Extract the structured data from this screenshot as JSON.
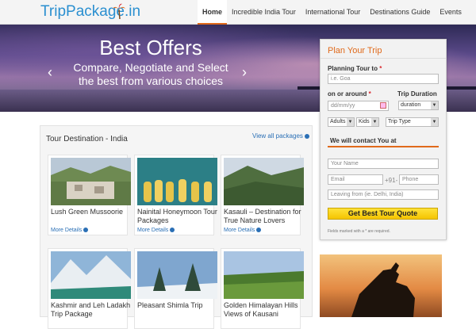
{
  "header": {
    "logo": "TripPackage.in",
    "nav": [
      "Home",
      "Incredible India Tour",
      "International Tour",
      "Destinations Guide",
      "Events"
    ]
  },
  "hero": {
    "title": "Best Offers",
    "subtitle_line1": "Compare, Negotiate and Select",
    "subtitle_line2": "the best from various choices",
    "prev": "‹",
    "next": "›"
  },
  "plan": {
    "title": "Plan Your Trip",
    "planning_label": "Planning Tour to",
    "planning_placeholder": "i.e. Goa",
    "on_or_around": "on or around",
    "trip_duration": "Trip Duration",
    "date_placeholder": "dd/mm/yy",
    "duration_value": "duration",
    "adults": "Adults",
    "kids": "Kids",
    "trip_type": "Trip Type",
    "contact_title": "We will contact You at",
    "name_placeholder": "Your Name",
    "email_placeholder": "Email",
    "phone_code": "+91-",
    "phone_placeholder": "Phone",
    "leaving_placeholder": "Leaving from (ie. Delhi, India)",
    "cta": "Get Best Tour Quote",
    "note": "Fields marked with a * are required."
  },
  "section": {
    "title": "Tour Destination - India",
    "view_all": "View all packages",
    "more_details": "More Details"
  },
  "cards": [
    {
      "title": "Lush Green Mussoorie",
      "more": true
    },
    {
      "title": "Nainital Honeymoon Tour Packages",
      "more": true
    },
    {
      "title": "Kasauli – Destination for True Nature Lovers",
      "more": true
    },
    {
      "title": "Kashmir and Leh Ladakh Trip Package",
      "more": false
    },
    {
      "title": "Pleasant Shimla Trip",
      "more": false
    },
    {
      "title": "Golden Himalayan Hills Views of Kausani",
      "more": false
    }
  ],
  "icons": [
    "palm-tree-icon",
    "calendar-icon",
    "chevron-down-icon",
    "arrow-right-circle-icon"
  ],
  "colors": {
    "accent": "#e06a1b",
    "link": "#2a6fb5",
    "logo": "#2a8fd0",
    "cta": "#f5c400"
  }
}
